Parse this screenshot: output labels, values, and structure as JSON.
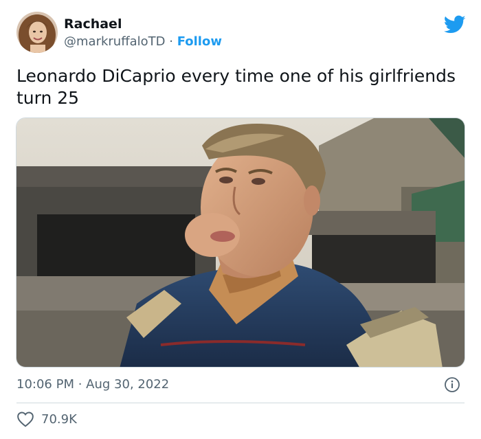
{
  "author": {
    "name": "Rachael",
    "handle": "@markruffaloTD",
    "separator": "·",
    "follow_label": "Follow"
  },
  "tweet": {
    "text": "Leonardo DiCaprio every time one of his girlfriends turn 25",
    "time": "10:06 PM",
    "dot": "·",
    "date": "Aug 30, 2022"
  },
  "engagement": {
    "likes": "70.9K"
  },
  "icons": {
    "brand": "twitter-bird-icon",
    "info": "info-icon",
    "like": "heart-icon"
  },
  "colors": {
    "accent": "#1d9bf0",
    "secondary_text": "#536471",
    "primary_text": "#0f1419",
    "divider": "#cfd9de"
  }
}
